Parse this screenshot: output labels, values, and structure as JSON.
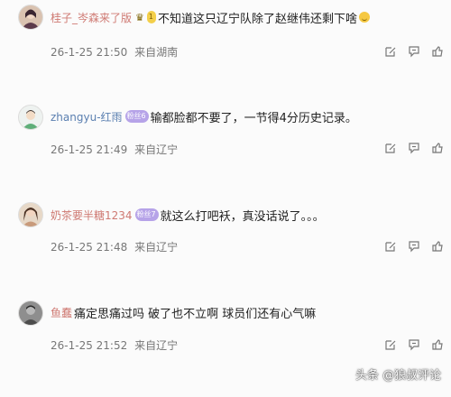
{
  "comments": [
    {
      "username": "桂子_岑森来了版",
      "badge": "1",
      "text": "不知道这只辽宁队除了赵继伟还剩下啥",
      "time": "26-1-25 21:50",
      "location": "来自湖南",
      "avatar_icon": "user-avatar-icon"
    },
    {
      "username": "zhangyu-红雨",
      "badge": "粉丝6",
      "text": "输都脸都不要了，一节得4分历史记录。",
      "time": "26-1-25 21:49",
      "location": "来自辽宁",
      "avatar_icon": "user-avatar-icon"
    },
    {
      "username": "奶茶要半糖1234",
      "badge": "粉丝7",
      "text": "就这么打吧袄，真没话说了。。。",
      "time": "26-1-25 21:48",
      "location": "来自辽宁",
      "avatar_icon": "user-avatar-icon"
    },
    {
      "username": "鱼蠢",
      "badge": "",
      "text": "痛定思痛过吗 破了也不立啊 球员们还有心气嘛",
      "time": "26-1-25 21:52",
      "location": "来自辽宁",
      "avatar_icon": "user-avatar-icon"
    }
  ],
  "actions": [
    "edit-icon",
    "reply-icon",
    "like-icon"
  ],
  "watermark": "头条 @狼叔评论"
}
